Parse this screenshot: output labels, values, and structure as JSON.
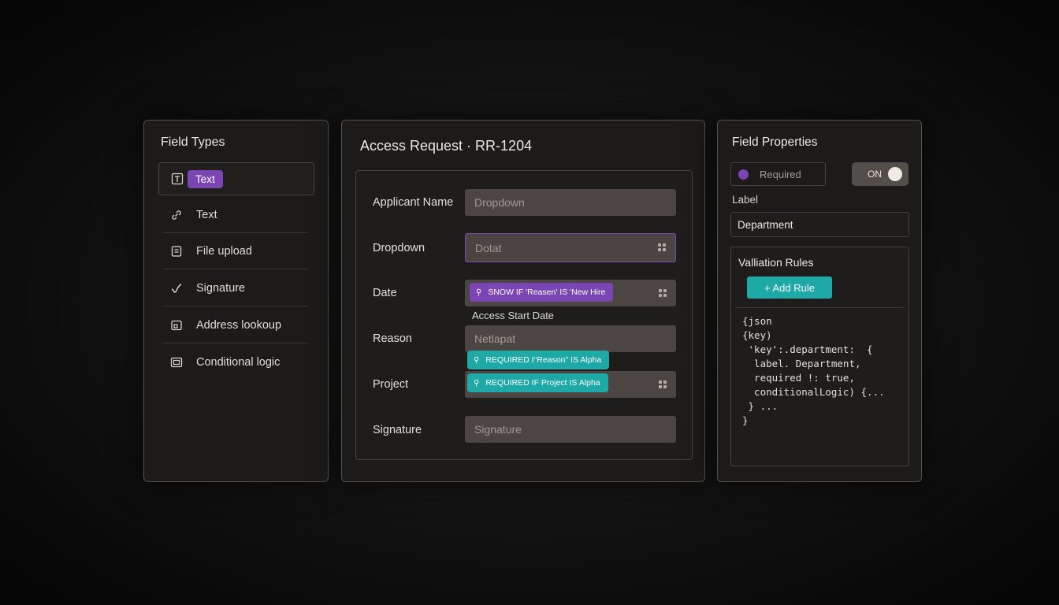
{
  "field_types": {
    "title": "Field Types",
    "items": [
      {
        "label": "Text",
        "icon": "text-field-icon",
        "selected": true
      },
      {
        "label": "Text",
        "icon": "link-icon",
        "selected": false
      },
      {
        "label": "File upload",
        "icon": "file-icon",
        "selected": false
      },
      {
        "label": "Signature",
        "icon": "signature-icon",
        "selected": false
      },
      {
        "label": "Address lookoup",
        "icon": "address-icon",
        "selected": false
      },
      {
        "label": "Conditional logic",
        "icon": "conditional-icon",
        "selected": false
      }
    ]
  },
  "form": {
    "title": "Access Request · RR-1204",
    "rows": [
      {
        "label": "Applicant Name",
        "value": "Dropdown"
      },
      {
        "label": "Dropdown",
        "value": "Dotat"
      },
      {
        "label": "Date",
        "value": ""
      },
      {
        "label": "Reason",
        "value": "Netlapat"
      },
      {
        "label": "Project",
        "value": ""
      },
      {
        "label": "Signature",
        "value": "Signature"
      }
    ],
    "rules": {
      "show_if_reason": "SNOW IF 'Reasen' IS 'New Hire",
      "required_if_reason": "REQUIRED I\"Reason\" IS Alpha",
      "required_if_project": "REQUIRED IF Project IS Alpha"
    },
    "access_start_caption": "Access Start Date"
  },
  "properties": {
    "title": "Field Properties",
    "required_label": "Required",
    "toggle_label": "ON",
    "label_title": "Label",
    "label_value": "Department",
    "validation_title": "Valliation Rules",
    "add_rule_label": "+ Add Rule",
    "code": "{json\n{key)\n 'key':.department:  {\n  label. Department,\n  required !: true,\n  conditionalLogic) {...\n } ...\n}"
  },
  "colors": {
    "accent_purple": "#7b45b3",
    "accent_teal": "#1ea9a6"
  }
}
